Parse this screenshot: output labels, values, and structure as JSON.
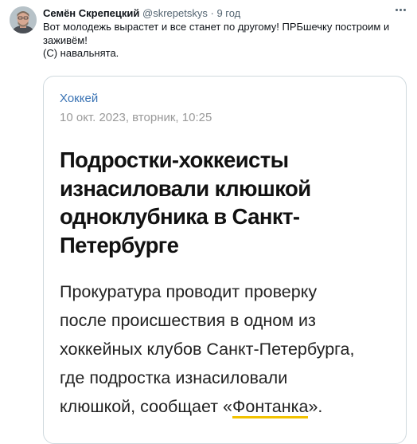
{
  "tweet": {
    "author_name": "Семён Скрепецкий",
    "author_handle": "@skrepetskys",
    "separator": "·",
    "time": "9 год",
    "text_lines": [
      "Вот молодежь вырастет и все станет по другому! ПРБшечку построим и",
      "заживём!",
      "(С) навальнята."
    ]
  },
  "article": {
    "rubric": "Хоккей",
    "date": "10 окт. 2023, вторник, 10:25",
    "headline_lines": [
      "Подростки-хоккеисты",
      "изнасиловали клюшкой",
      "одноклубника в Санкт-",
      "Петербурге"
    ],
    "lead_lines": [
      "Прокуратура проводит проверку",
      "после происшествия в одном из",
      "хоккейных клубов Санкт-Петербурга,",
      "где подростка изнасиловали"
    ],
    "lead_last_prefix": "клюшкой, сообщает «",
    "source_link": "Фонтанка",
    "lead_last_suffix": "»."
  },
  "colors": {
    "rubric": "#3a73b4",
    "link_underline": "#f2c200",
    "muted": "#536471"
  }
}
